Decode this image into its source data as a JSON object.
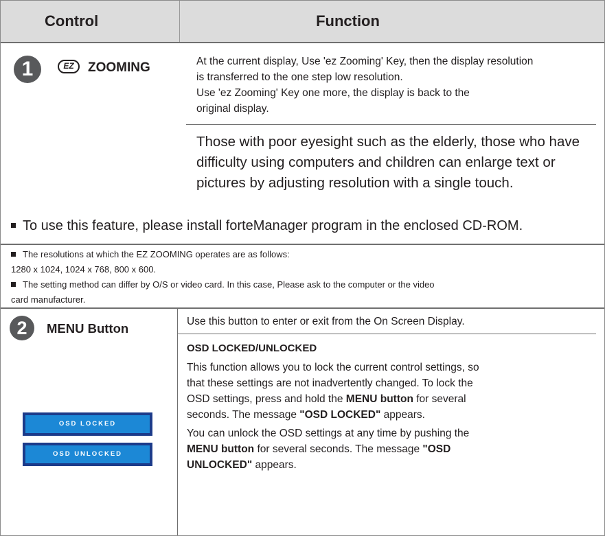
{
  "header": {
    "col_control": "Control",
    "col_function": "Function"
  },
  "section1": {
    "number": "1",
    "control_name": "ZOOMING",
    "ez_icon_text": "EZ",
    "desc_lines": [
      "At the current display, Use 'ez Zooming' Key, then the display resolution",
      "is transferred to the one step low resolution.",
      "Use 'ez Zooming' Key one more, the display is back to the",
      "original display."
    ],
    "benefit_lines": [
      "Those with poor eyesight such as the elderly, those who have",
      "difficulty using computers and children can enlarge text or",
      "pictures by adjusting resolution with a single touch."
    ],
    "install_note": "To use this feature, please install forteManager program in the enclosed CD-ROM."
  },
  "notes": {
    "note1_line1": "The resolutions at which the EZ ZOOMING operates are as follows:",
    "note1_line2": "1280 x 1024, 1024 x 768, 800 x 600.",
    "note2_line1": "The setting method can differ by O/S or video card. In this case, Please ask to the computer or the video",
    "note2_line2": "card manufacturer."
  },
  "section2": {
    "number": "2",
    "control_name": "MENU Button",
    "osd_locked_label": "OSD LOCKED",
    "osd_unlocked_label": "OSD UNLOCKED",
    "enter_exit": "Use this button to enter or exit from the On Screen Display.",
    "subheading": "OSD LOCKED/UNLOCKED",
    "para1": {
      "l1": "This function allows you to lock the current control settings, so",
      "l2": "that these settings are not inadvertently changed. To lock the",
      "l3_a": "OSD settings, press and hold the ",
      "l3_b": "MENU button",
      "l3_c": " for several",
      "l4_a": "seconds. The message ",
      "l4_b": "\"OSD LOCKED\"",
      "l4_c": " appears."
    },
    "para2": {
      "l1": "You can unlock the OSD settings at any time by pushing the",
      "l2_a": "MENU button",
      "l2_b": " for several seconds. The message ",
      "l2_c": "\"OSD",
      "l3_a": "UNLOCKED\"",
      "l3_b": " appears."
    }
  }
}
